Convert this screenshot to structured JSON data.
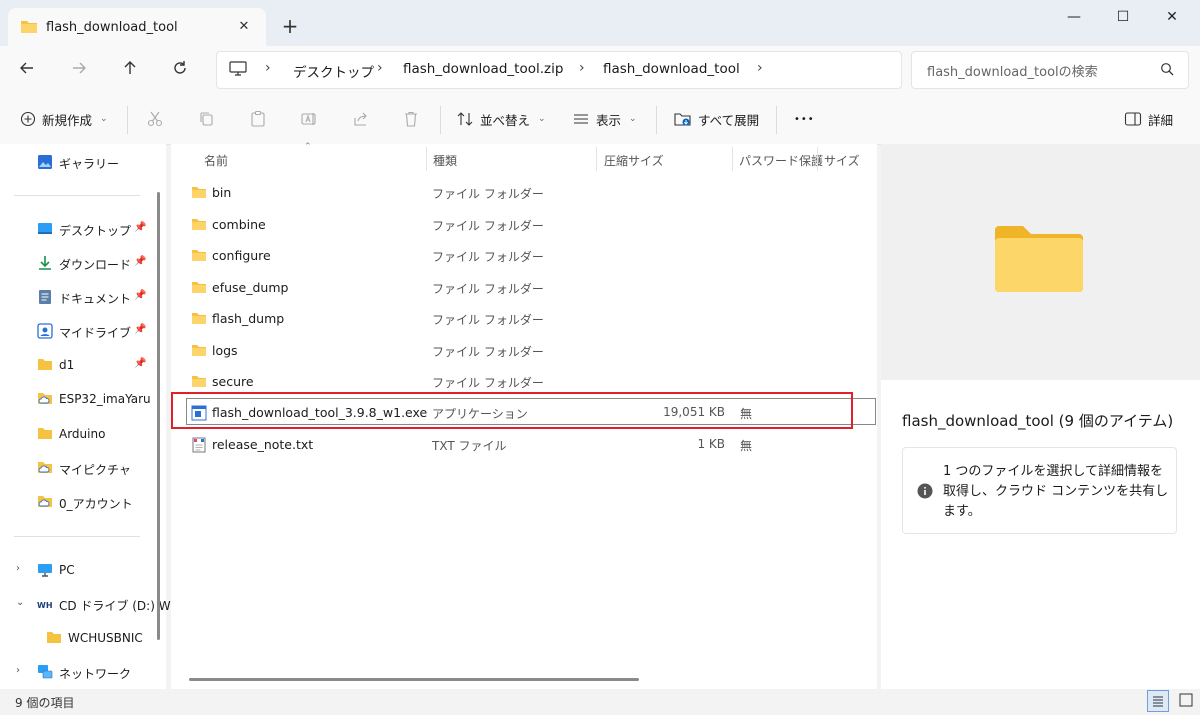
{
  "window": {
    "tab_title": "flash_download_tool",
    "new_tab": "+",
    "tab_close": "✕",
    "minimize": "—",
    "maximize": "☐",
    "close": "✕"
  },
  "address": {
    "crumbs": [
      "デスクトップ",
      "flash_download_tool.zip",
      "flash_download_tool"
    ],
    "search_placeholder": "flash_download_toolの検索"
  },
  "commands": {
    "new": "新規作成",
    "sort": "並べ替え",
    "view": "表示",
    "expand_all": "すべて展開",
    "more": "•••",
    "details": "詳細"
  },
  "nav": {
    "gallery": "ギャラリー",
    "pinned": [
      "デスクトップ",
      "ダウンロード",
      "ドキュメント",
      "マイドライブ",
      "d1"
    ],
    "folders": [
      "ESP32_imaYaru",
      "Arduino",
      "マイピクチャ",
      "0_アカウント"
    ],
    "pc": "PC",
    "cd_drive": "CD ドライブ (D:) W",
    "wchusbnic": "WCHUSBNIC",
    "network": "ネットワーク"
  },
  "columns": {
    "name": "名前",
    "type": "種類",
    "compressed_size": "圧縮サイズ",
    "password": "パスワード保護",
    "size": "サイズ"
  },
  "files": [
    {
      "name": "bin",
      "type": "ファイル フォルダー",
      "size": "",
      "password": "",
      "kind": "folder"
    },
    {
      "name": "combine",
      "type": "ファイル フォルダー",
      "size": "",
      "password": "",
      "kind": "folder"
    },
    {
      "name": "configure",
      "type": "ファイル フォルダー",
      "size": "",
      "password": "",
      "kind": "folder"
    },
    {
      "name": "efuse_dump",
      "type": "ファイル フォルダー",
      "size": "",
      "password": "",
      "kind": "folder"
    },
    {
      "name": "flash_dump",
      "type": "ファイル フォルダー",
      "size": "",
      "password": "",
      "kind": "folder"
    },
    {
      "name": "logs",
      "type": "ファイル フォルダー",
      "size": "",
      "password": "",
      "kind": "folder"
    },
    {
      "name": "secure",
      "type": "ファイル フォルダー",
      "size": "",
      "password": "",
      "kind": "folder"
    },
    {
      "name": "flash_download_tool_3.9.8_w1.exe",
      "type": "アプリケーション",
      "size": "19,051 KB",
      "password": "無",
      "kind": "exe"
    },
    {
      "name": "release_note.txt",
      "type": "TXT ファイル",
      "size": "1 KB",
      "password": "無",
      "kind": "txt"
    }
  ],
  "preview": {
    "title": "flash_download_tool (9 個のアイテム)",
    "info": "1 つのファイルを選択して詳細情報を取得し、クラウド コンテンツを共有します。"
  },
  "status": {
    "count": "9 個の項目"
  },
  "colors": {
    "folder": "#f5c242",
    "highlight": "#e0202a",
    "accent": "#0067c0"
  }
}
